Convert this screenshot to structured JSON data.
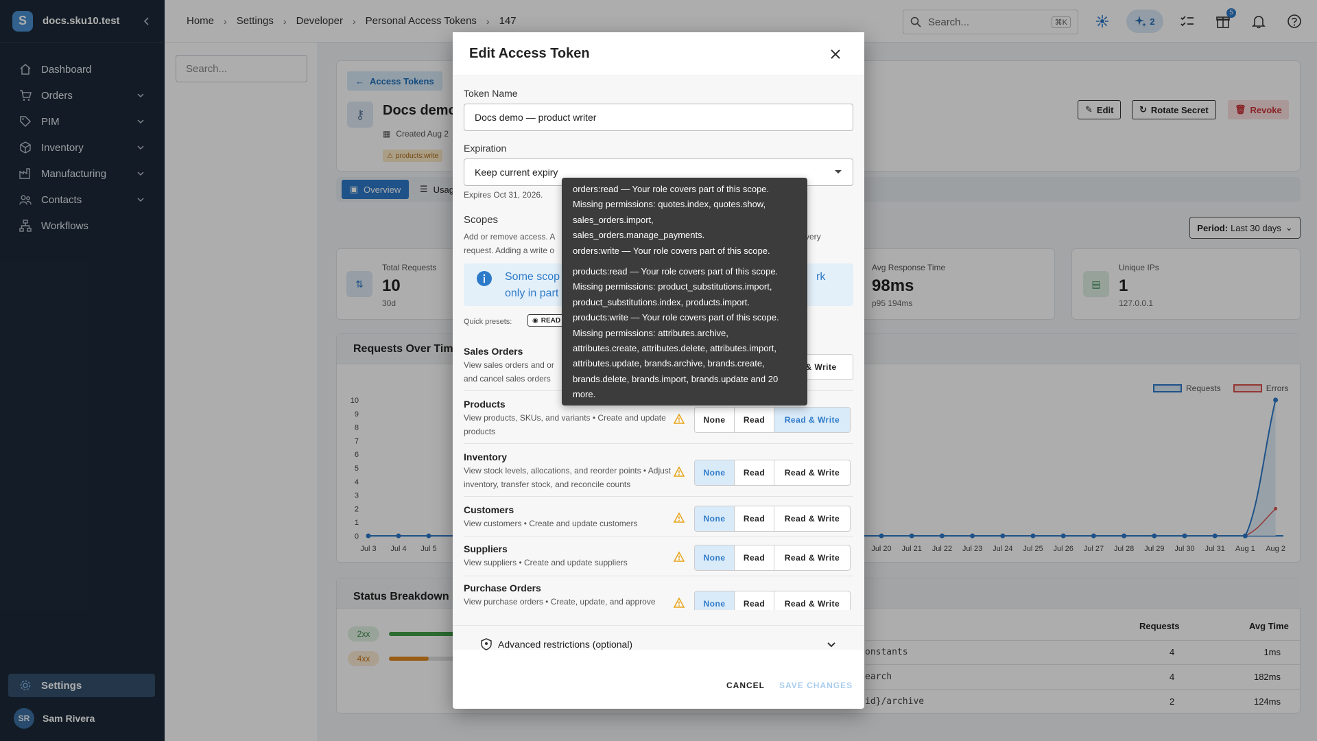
{
  "sidebar": {
    "title": "docs.sku10.test",
    "logo_letter": "S",
    "items": [
      {
        "label": "Dashboard",
        "icon": "home-icon"
      },
      {
        "label": "Orders",
        "icon": "cart-icon"
      },
      {
        "label": "PIM",
        "icon": "tag-icon"
      },
      {
        "label": "Inventory",
        "icon": "box-icon"
      },
      {
        "label": "Manufacturing",
        "icon": "factory-icon"
      },
      {
        "label": "Contacts",
        "icon": "people-icon"
      },
      {
        "label": "Workflows",
        "icon": "workflow-icon"
      }
    ],
    "settings_label": "Settings",
    "user": {
      "initials": "SR",
      "name": "Sam Rivera"
    }
  },
  "header": {
    "breadcrumbs": [
      "Home",
      "Settings",
      "Developer",
      "Personal Access Tokens",
      "147"
    ],
    "search_placeholder": "Search...",
    "search_shortcut": "⌘K",
    "ai_count": "2",
    "gift_badge": "5"
  },
  "background": {
    "search_placeholder": "Search...",
    "back_label": "Access Tokens",
    "token_title": "Docs demo",
    "created_text": "Created Aug 2",
    "scope_chip": "products:write",
    "edit_label": "Edit",
    "rotate_label": "Rotate Secret",
    "revoke_label": "Revoke",
    "tab_overview": "Overview",
    "tab_usage": "Usag",
    "period_label": "Period:",
    "period_value": "Last 30 days",
    "stats": [
      {
        "label": "Total Requests",
        "value": "10",
        "sub": "30d"
      },
      {
        "label": "Avg Response Time",
        "value": "98ms",
        "sub": "p95 194ms"
      },
      {
        "label": "Unique IPs",
        "value": "1",
        "sub": "127.0.0.1"
      }
    ],
    "chart_title": "Requests Over Time",
    "legend": [
      "Requests",
      "Errors"
    ],
    "status_title": "Status Breakdown",
    "status_codes": [
      "2xx",
      "4xx"
    ],
    "table_headers": [
      "Requests",
      "Avg Time"
    ],
    "table_rows": [
      {
        "endpoint": "onstants",
        "requests": "4",
        "time": "1ms"
      },
      {
        "endpoint": "earch",
        "requests": "4",
        "time": "182ms"
      },
      {
        "endpoint": "id}/archive",
        "requests": "2",
        "time": "124ms"
      }
    ]
  },
  "chart_data": {
    "type": "line",
    "title": "Requests Over Time",
    "x_left": [
      "Jul 3",
      "Jul 4",
      "Jul 5"
    ],
    "x_right": [
      "Jul 20",
      "Jul 21",
      "Jul 22",
      "Jul 23",
      "Jul 24",
      "Jul 25",
      "Jul 26",
      "Jul 27",
      "Jul 28",
      "Jul 29",
      "Jul 30",
      "Jul 31",
      "Aug 1",
      "Aug 2"
    ],
    "y_ticks": [
      "0",
      "1",
      "2",
      "3",
      "4",
      "5",
      "6",
      "7",
      "8",
      "9",
      "10"
    ],
    "ylim": [
      0,
      10
    ],
    "series": [
      {
        "name": "Requests",
        "color": "#2d7ac9",
        "aug2": 10
      },
      {
        "name": "Errors",
        "color": "#d9534f",
        "aug2": 2
      }
    ]
  },
  "dialog": {
    "title": "Edit Access Token",
    "token_name_label": "Token Name",
    "token_name_value": "Docs demo — product writer",
    "expiration_label": "Expiration",
    "expiration_value": "Keep current expiry",
    "expires_helper": "Expires Oct 31, 2026.",
    "scopes_label": "Scopes",
    "scopes_help_1": "Add or remove access. A",
    "scopes_help_1b": "very",
    "scopes_help_2": "request. Adding a write o",
    "info_line1": "Some scop",
    "info_line1b": "rk",
    "info_line2": "only in part",
    "quick_presets_label": "Quick presets:",
    "preset_read": "READ",
    "scopes": [
      {
        "name": "Sales Orders",
        "desc": "View sales orders and or",
        "desc2": "and cancel sales orders",
        "active": "Read & Write",
        "options_visible": [
          "& Write"
        ]
      },
      {
        "name": "Products",
        "desc": "View products, SKUs, and variants • Create and update products",
        "active": "Read & Write"
      },
      {
        "name": "Inventory",
        "desc": "View stock levels, allocations, and reorder points • Adjust inventory, transfer stock, and reconcile counts",
        "active": "None"
      },
      {
        "name": "Customers",
        "desc": "View customers • Create and update customers",
        "active": "None"
      },
      {
        "name": "Suppliers",
        "desc": "View suppliers • Create and update suppliers",
        "active": "None"
      },
      {
        "name": "Purchase Orders",
        "desc": "View purchase orders • Create, update, and approve purchase orders",
        "active": "None"
      }
    ],
    "seg_labels": [
      "None",
      "Read",
      "Read & Write"
    ],
    "advanced_label": "Advanced restrictions (optional)",
    "cancel_label": "CANCEL",
    "save_label": "SAVE CHANGES"
  },
  "tooltip": {
    "lines": [
      "orders:read — Your role covers part of this scope.",
      "Missing permissions: quotes.index, quotes.show,",
      "sales_orders.import,",
      "sales_orders.manage_payments.",
      "orders:write — Your role covers part of this scope.",
      "products:read — Your role covers part of this scope.",
      "Missing permissions: product_substitutions.import,",
      "product_substitutions.index, products.import.",
      "products:write — Your role covers part of this scope.",
      "Missing permissions: attributes.archive,",
      "attributes.create, attributes.delete, attributes.import,",
      "attributes.update, brands.archive, brands.create,",
      "brands.delete, brands.import, brands.update and 20",
      "more."
    ]
  }
}
